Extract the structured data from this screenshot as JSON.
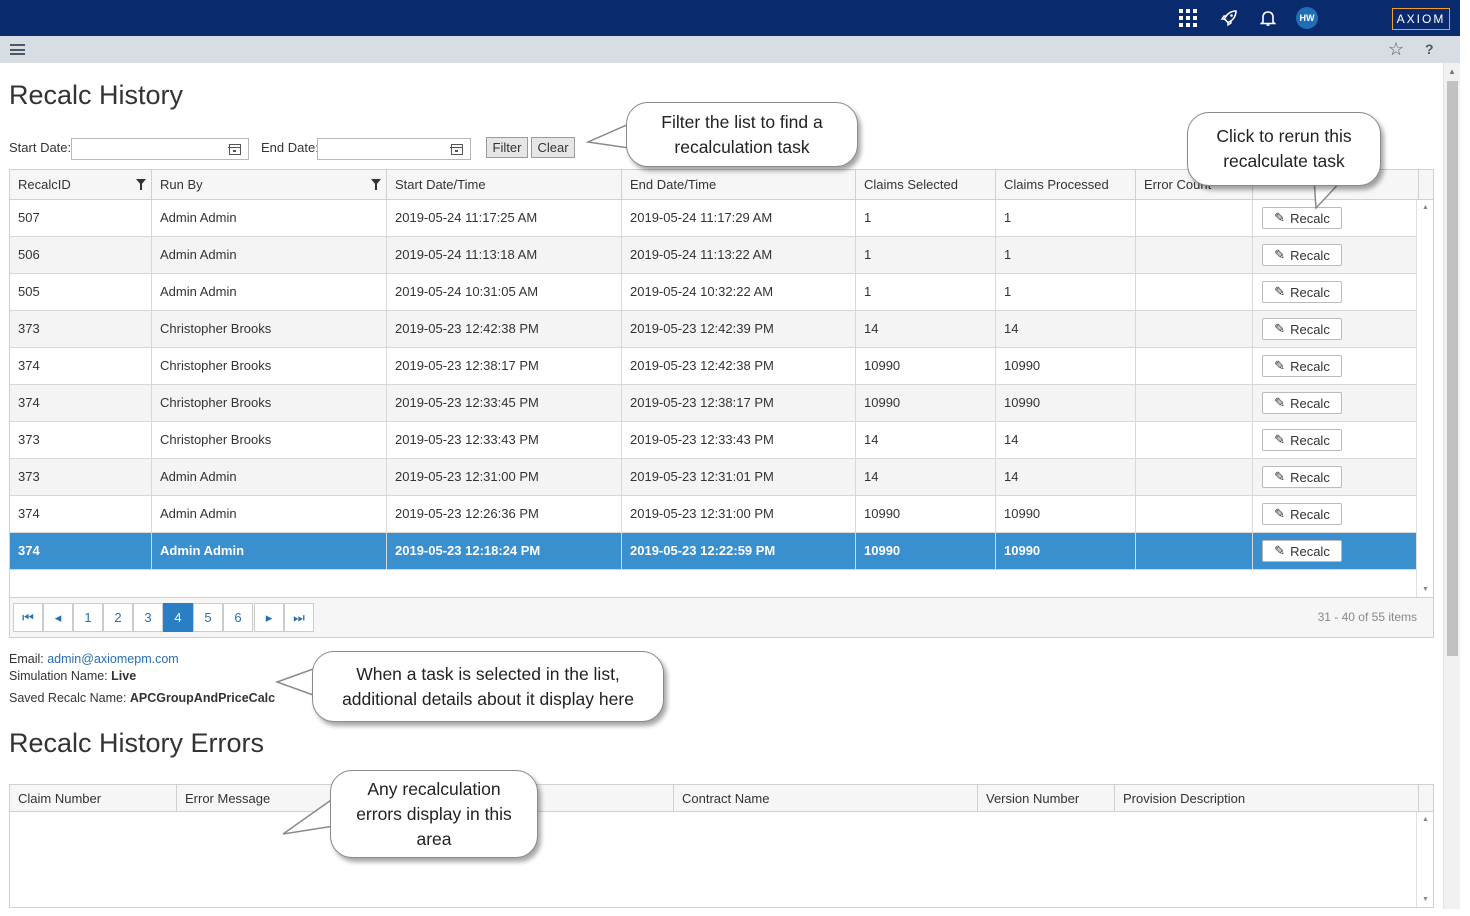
{
  "topbar": {
    "avatar_initials": "HW",
    "logo_text": "AXIOM"
  },
  "page": {
    "title": "Recalc History",
    "errors_title": "Recalc History Errors"
  },
  "filters": {
    "start_label": "Start Date:",
    "end_label": "End Date:",
    "start_value": "",
    "end_value": "",
    "filter_button": "Filter",
    "clear_button": "Clear"
  },
  "grid": {
    "columns": [
      "RecalcID",
      "Run By",
      "Start Date/Time",
      "End Date/Time",
      "Claims Selected",
      "Claims Processed",
      "Error Count"
    ],
    "recalc_button": "Recalc",
    "rows": [
      {
        "id": "507",
        "run_by": "Admin Admin",
        "start": "2019-05-24 11:17:25 AM",
        "end": "2019-05-24 11:17:29 AM",
        "selected": "1",
        "processed": "1",
        "errors": ""
      },
      {
        "id": "506",
        "run_by": "Admin Admin",
        "start": "2019-05-24 11:13:18 AM",
        "end": "2019-05-24 11:13:22 AM",
        "selected": "1",
        "processed": "1",
        "errors": ""
      },
      {
        "id": "505",
        "run_by": "Admin Admin",
        "start": "2019-05-24 10:31:05 AM",
        "end": "2019-05-24 10:32:22 AM",
        "selected": "1",
        "processed": "1",
        "errors": ""
      },
      {
        "id": "373",
        "run_by": "Christopher Brooks",
        "start": "2019-05-23 12:42:38 PM",
        "end": "2019-05-23 12:42:39 PM",
        "selected": "14",
        "processed": "14",
        "errors": ""
      },
      {
        "id": "374",
        "run_by": "Christopher Brooks",
        "start": "2019-05-23 12:38:17 PM",
        "end": "2019-05-23 12:42:38 PM",
        "selected": "10990",
        "processed": "10990",
        "errors": ""
      },
      {
        "id": "374",
        "run_by": "Christopher Brooks",
        "start": "2019-05-23 12:33:45 PM",
        "end": "2019-05-23 12:38:17 PM",
        "selected": "10990",
        "processed": "10990",
        "errors": ""
      },
      {
        "id": "373",
        "run_by": "Christopher Brooks",
        "start": "2019-05-23 12:33:43 PM",
        "end": "2019-05-23 12:33:43 PM",
        "selected": "14",
        "processed": "14",
        "errors": ""
      },
      {
        "id": "373",
        "run_by": "Admin Admin",
        "start": "2019-05-23 12:31:00 PM",
        "end": "2019-05-23 12:31:01 PM",
        "selected": "14",
        "processed": "14",
        "errors": ""
      },
      {
        "id": "374",
        "run_by": "Admin Admin",
        "start": "2019-05-23 12:26:36 PM",
        "end": "2019-05-23 12:31:00 PM",
        "selected": "10990",
        "processed": "10990",
        "errors": ""
      },
      {
        "id": "374",
        "run_by": "Admin Admin",
        "start": "2019-05-23 12:18:24 PM",
        "end": "2019-05-23 12:22:59 PM",
        "selected": "10990",
        "processed": "10990",
        "errors": ""
      }
    ],
    "selected_row_index": 9
  },
  "pager": {
    "pages": [
      "1",
      "2",
      "3",
      "4",
      "5",
      "6"
    ],
    "current_page": "4",
    "info": "31 - 40 of 55 items"
  },
  "details": {
    "email_label": "Email:",
    "email_value": "admin@axiomepm.com",
    "simulation_label": "Simulation Name:",
    "simulation_value": "Live",
    "saved_label": "Saved Recalc Name:",
    "saved_value": "APCGroupAndPriceCalc"
  },
  "errors_grid": {
    "columns": [
      "Claim Number",
      "Error Message",
      "Contract Name",
      "Version Number",
      "Provision Description"
    ]
  },
  "callouts": {
    "filter": "Filter the list to find a recalculation task",
    "rerun": "Click to rerun this recalculate task",
    "details": "When a task is selected in the list, additional details about it display here",
    "errors": "Any recalculation errors display in this area"
  },
  "icons": [
    "grid-icon",
    "rocket-icon",
    "bell-icon",
    "hamburger-icon",
    "star-icon",
    "help-icon",
    "calendar-icon",
    "filter-icon",
    "pencil-icon",
    "first-page-icon",
    "prev-page-icon",
    "next-page-icon",
    "last-page-icon"
  ],
  "colors": {
    "topbar": "#0a2a6e",
    "subbar": "#d7dde3",
    "selected_row": "#3a8fcf",
    "active_page": "#2a7fc4",
    "logo_border": "#f0a030"
  }
}
